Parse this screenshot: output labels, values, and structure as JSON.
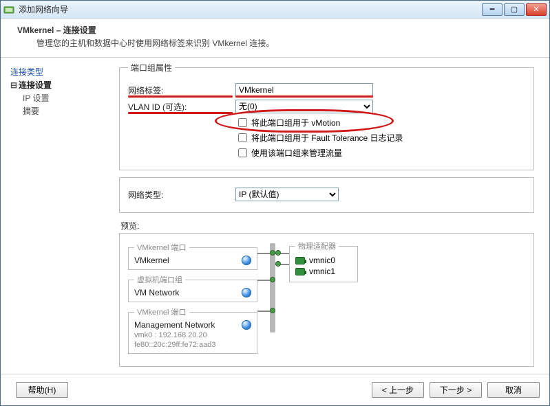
{
  "window": {
    "title": "添加网络向导"
  },
  "header": {
    "title": "VMkernel – 连接设置",
    "subtitle": "管理您的主机和数据中心时使用网络标签来识别 VMkernel 连接。"
  },
  "sidebar": {
    "items": [
      {
        "label": "连接类型"
      },
      {
        "label": "连接设置"
      },
      {
        "label": "IP 设置"
      },
      {
        "label": "摘要"
      }
    ]
  },
  "groupbox": {
    "legend": "端口组属性",
    "network_label": "网络标签:",
    "network_value": "VMkernel",
    "vlan_label": "VLAN ID (可选):",
    "vlan_value": "无(0)",
    "chk_vmotion": "将此端口组用于 vMotion",
    "chk_ft": "将此端口组用于 Fault Tolerance 日志记录",
    "chk_mgmt": "使用该端口组来管理流量"
  },
  "nettype": {
    "label": "网络类型:",
    "value": "IP (默认值)"
  },
  "preview": {
    "label": "预览:",
    "svc_vmk_port_legend": "VMkernel 端口",
    "svc_vmk_name": "VMkernel",
    "svc_vm_port_legend": "虚拟机端口组",
    "svc_vm_name": "VM Network",
    "svc_mgmt_legend": "VMkernel 端口",
    "svc_mgmt_name": "Management Network",
    "svc_mgmt_ip": "vmk0 : 192.168.20.20",
    "svc_mgmt_ipv6": "fe80::20c:29ff:fe72:aad3",
    "phys_legend": "物理适配器",
    "nic0": "vmnic0",
    "nic1": "vmnic1"
  },
  "footer": {
    "help": "帮助(H)",
    "back": "< 上一步",
    "next": "下一步 >",
    "cancel": "取消"
  }
}
